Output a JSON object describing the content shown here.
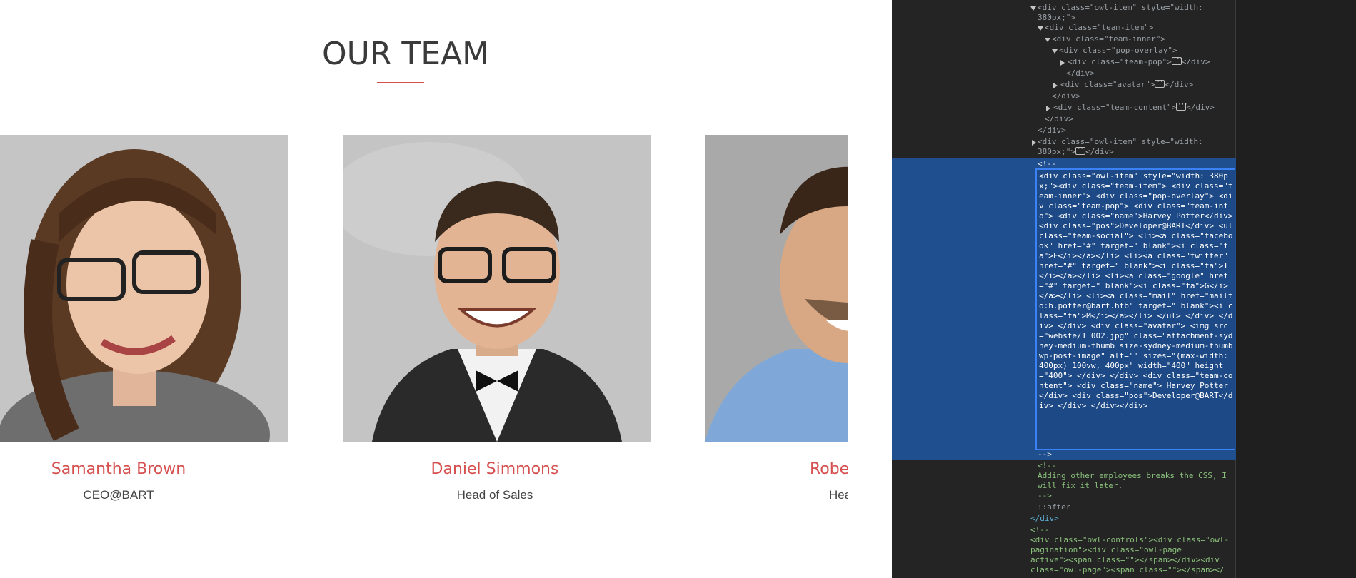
{
  "section": {
    "title": "OUR TEAM"
  },
  "team": [
    {
      "name": "Samantha Brown",
      "pos": "CEO@BART"
    },
    {
      "name": "Daniel Simmons",
      "pos": "Head of Sales"
    },
    {
      "name": "Robe",
      "pos": "Hea"
    }
  ],
  "colors": {
    "accent": "#d65050",
    "devtools_bg": "#242424",
    "selection": "#1f4f8f"
  },
  "devtools": {
    "line01": "<div class=\"owl-item\" style=\"width:",
    "line02": "380px;\">",
    "line03": "<div class=\"team-item\">",
    "line04": "<div class=\"team-inner\">",
    "line05": "<div class=\"pop-overlay\">",
    "line06a": "<div class=\"team-pop\">",
    "line06b": "</div>",
    "line07": "</div>",
    "line08a": "<div class=\"avatar\">",
    "line08b": "</div>",
    "line09": "</div>",
    "line10a": "<div class=\"team-content\">",
    "line10b": "</div>",
    "line11": "</div>",
    "line12": "</div>",
    "line13": "<div class=\"owl-item\" style=\"width:",
    "line14a": "380px;\">",
    "line14b": "</div>",
    "line15": "<!--",
    "selected_comment": "<div class=\"owl-item\" style=\"width: 380px;\"><div class=\"team-item\"> <div class=\"team-inner\"> <div class=\"pop-overlay\"> <div class=\"team-pop\"> <div class=\"team-info\"> <div class=\"name\">Harvey Potter</div> <div class=\"pos\">Developer@BART</div> <ul class=\"team-social\"> <li><a class=\"facebook\" href=\"#\" target=\"_blank\"><i class=\"fa\">F</i></a></li> <li><a class=\"twitter\" href=\"#\" target=\"_blank\"><i class=\"fa\">T</i></a></li> <li><a class=\"google\" href=\"#\" target=\"_blank\"><i class=\"fa\">G</i></a></li> <li><a class=\"mail\" href=\"mailto:h.potter@bart.htb\" target=\"_blank\"><i class=\"fa\">M</i></a></li> </ul> </div> </div> </div> <div class=\"avatar\"> <img src=\"webste/1_002.jpg\" class=\"attachment-sydney-medium-thumb size-sydney-medium-thumb wp-post-image\" alt=\"\" sizes=\"(max-width: 400px) 100vw, 400px\" width=\"400\" height=\"400\"> </div> </div> <div class=\"team-content\"> <div class=\"name\"> Harvey Potter </div> <div class=\"pos\">Developer@BART</div> </div> </div></div>",
    "line16": "-->",
    "line17": "<!--",
    "line18": "Adding other employees breaks the CSS, I",
    "line19": "will fix it later.",
    "line20": "-->",
    "line21": "::after",
    "line22": "</div>",
    "line23": "<!--",
    "line24": "<div class=\"owl-controls\"><div class=\"owl-",
    "line25": "pagination\"><div class=\"owl-page",
    "line26": "active\"><span class=\"\"></span></div><div",
    "line27": "class=\"owl-page\"><span class=\"\"></span></"
  }
}
